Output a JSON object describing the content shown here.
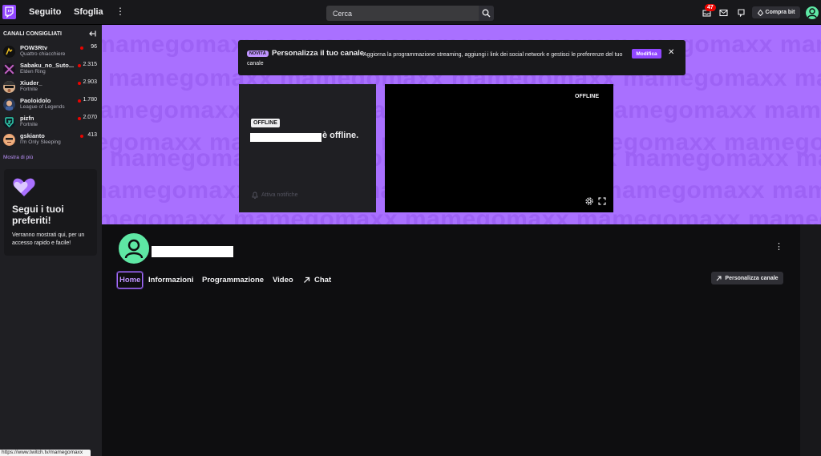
{
  "topnav": {
    "following": "Seguito",
    "browse": "Sfoglia",
    "search_placeholder": "Cerca",
    "notifications_count": "47",
    "bits_label": "Compra bit"
  },
  "sidebar": {
    "title": "CANALI CONSIGLIATI",
    "channels": [
      {
        "name": "POW3Rtv",
        "game": "Quattro chiacchiere",
        "viewers": "96"
      },
      {
        "name": "Sabaku_no_Suto...",
        "game": "Elden Ring",
        "viewers": "2.315"
      },
      {
        "name": "Xiuder_",
        "game": "Fortnite",
        "viewers": "2.903"
      },
      {
        "name": "Paoloidolo",
        "game": "League of Legends",
        "viewers": "1.780"
      },
      {
        "name": "pizfn",
        "game": "Fortnite",
        "viewers": "2.070"
      },
      {
        "name": "gskianto",
        "game": "I'm Only Sleeping",
        "viewers": "413"
      }
    ],
    "show_more": "Mostra di più",
    "follow_card": {
      "title": "Segui i tuoi preferiti!",
      "subtitle": "Verranno mostrati qui, per un accesso rapido e facile!"
    }
  },
  "banner": {
    "watermark": "mamegomaxx"
  },
  "notice": {
    "tag": "NOVITÀ",
    "title": "Personalizza il tuo canale",
    "description": "Aggiorna la programmazione streaming, aggiungi i link dei social network e gestisci le preferenze del tuo canale",
    "button": "Modifica"
  },
  "offline_card": {
    "tag": "OFFLINE",
    "text": "è offline.",
    "notifications": "Attiva notifiche"
  },
  "player": {
    "status": "OFFLINE"
  },
  "channel": {
    "tabs": [
      "Home",
      "Informazioni",
      "Programmazione",
      "Video",
      "Chat"
    ],
    "customize_button": "Personalizza canale"
  },
  "statusbar": {
    "url": "https://www.twitch.tv/mamegomaxx"
  },
  "colors": {
    "accent": "#9147ff",
    "banner": "#a970ff",
    "live": "#eb0400",
    "avatar": "#5ee7a4"
  }
}
